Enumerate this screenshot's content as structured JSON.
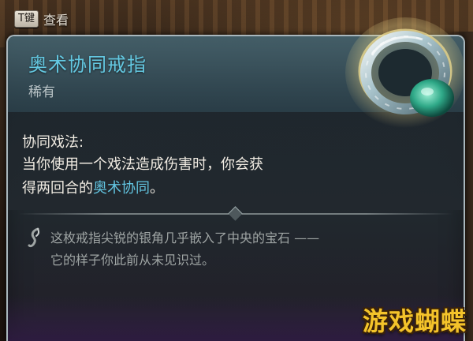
{
  "key_hint": {
    "key": "T键",
    "label": "查看"
  },
  "item": {
    "name": "奥术协同戒指",
    "rarity": "稀有",
    "ring_icon": "ring-icon"
  },
  "effect": {
    "title": "协同戏法:",
    "line1": "当你使用一个戏法造成伤害时，你会获",
    "line2_prefix": "得两回合的",
    "line2_highlight": "奥术协同",
    "line2_suffix": "。"
  },
  "lore": {
    "icon": "quill-icon",
    "line1": "这枚戒指尖锐的银角几乎嵌入了中央的宝石 ——",
    "line2": "它的样子你此前从未见识过。"
  },
  "watermark": "游戏蝴蝶",
  "colors": {
    "item_name": "#64c9e2",
    "highlight": "#62c4e0",
    "panel_border": "#a9b7bd",
    "watermark": "#f4c32a"
  }
}
